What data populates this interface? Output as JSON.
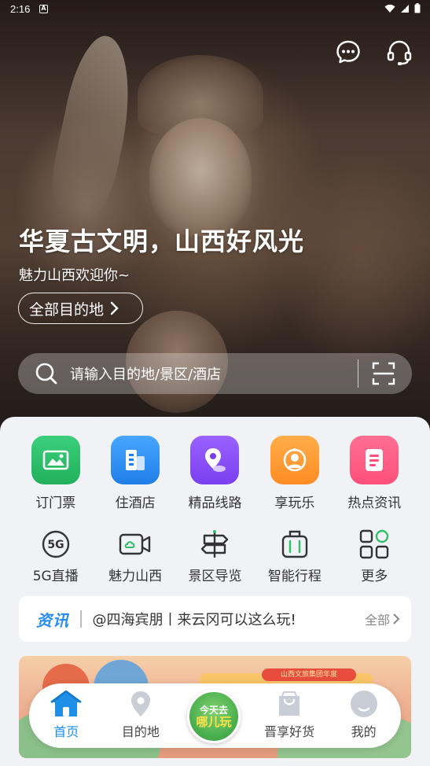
{
  "status_bar": {
    "time": "2:16",
    "app_icon": "A"
  },
  "hero": {
    "title": "华夏古文明，山西好风光",
    "subtitle": "魅力山西欢迎你~",
    "all_destinations_label": "全部目的地"
  },
  "search": {
    "placeholder": "请输入目的地/景区/酒店"
  },
  "categories": [
    {
      "label": "订门票",
      "icon": "ticket-icon",
      "color": "#2fbf6a"
    },
    {
      "label": "住酒店",
      "icon": "hotel-icon",
      "color": "#2f8ff0"
    },
    {
      "label": "精品线路",
      "icon": "route-icon",
      "color": "#8a4ff0"
    },
    {
      "label": "享玩乐",
      "icon": "fun-icon",
      "color": "#ff9b36"
    },
    {
      "label": "热点资讯",
      "icon": "news-icon",
      "color": "#ff5c86"
    }
  ],
  "services": [
    {
      "label": "5G直播",
      "icon": "5g-icon"
    },
    {
      "label": "魅力山西",
      "icon": "video-camera-icon"
    },
    {
      "label": "景区导览",
      "icon": "guide-sign-icon"
    },
    {
      "label": "智能行程",
      "icon": "luggage-icon"
    },
    {
      "label": "更多",
      "icon": "more-grid-icon"
    }
  ],
  "news": {
    "tag": "资讯",
    "text": "@四海宾朋丨来云冈可以这么玩!",
    "more_label": "全部"
  },
  "banner": {
    "ribbon_text": "山西文旅集团年度"
  },
  "nav": {
    "items": [
      {
        "label": "首页",
        "icon": "home-icon",
        "active": true
      },
      {
        "label": "目的地",
        "icon": "location-pin-icon",
        "active": false
      },
      {
        "label": "晋享好货",
        "icon": "shopping-bag-icon",
        "active": false
      },
      {
        "label": "我的",
        "icon": "profile-icon",
        "active": false
      }
    ],
    "center_line1": "今天去",
    "center_line2": "哪儿玩"
  },
  "colors": {
    "accent": "#1d8fe6",
    "news_tag": "#2a8cf0"
  }
}
